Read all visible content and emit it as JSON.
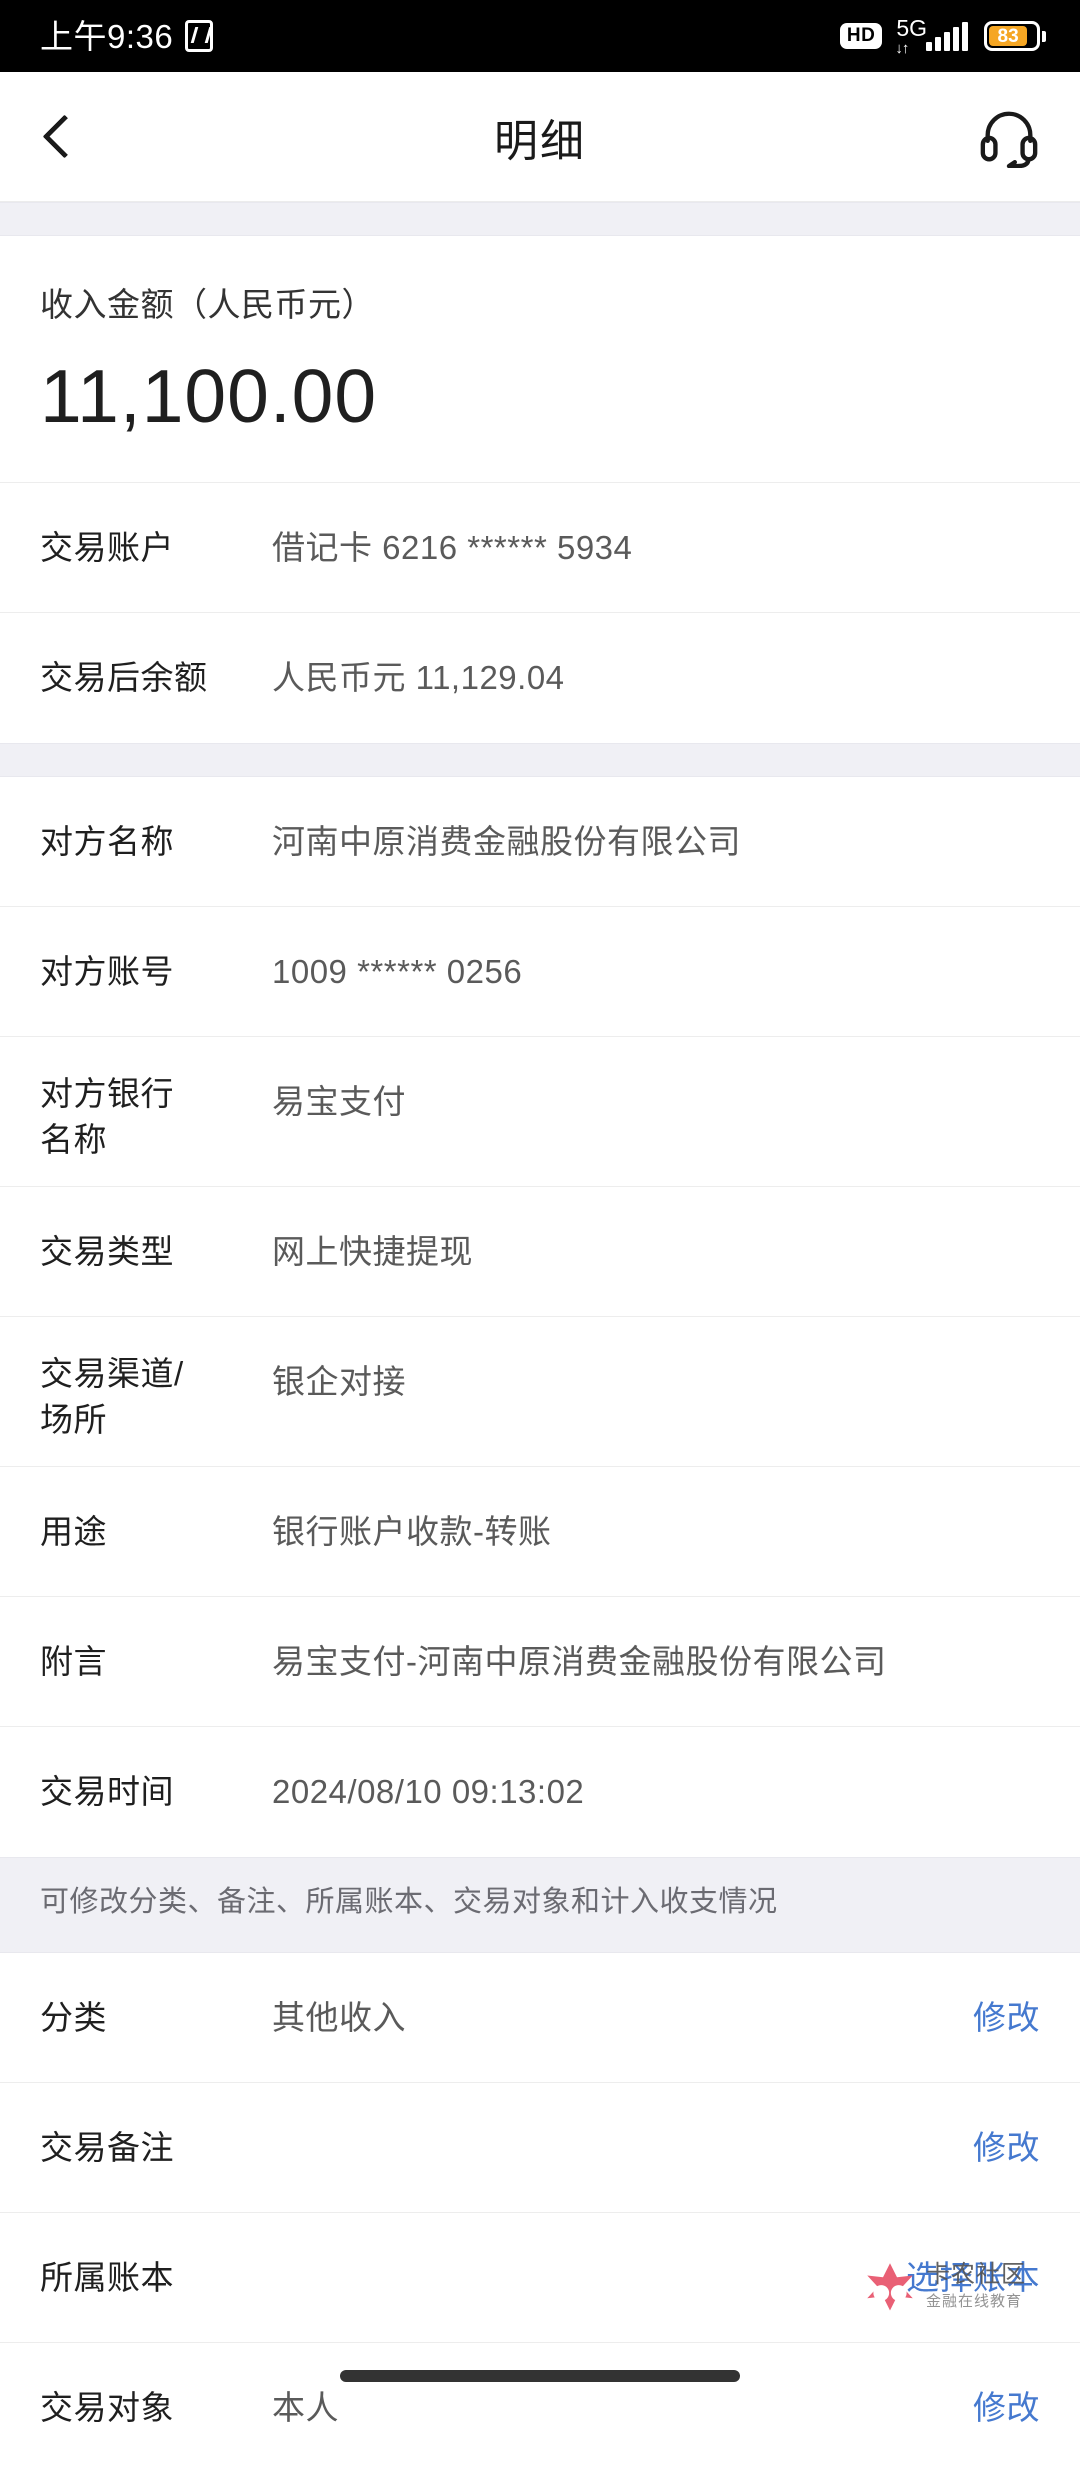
{
  "status_bar": {
    "time": "上午9:36",
    "nfc_icon": "nfc-icon",
    "hd_label": "HD",
    "network_label": "5G",
    "data_arrows": "↓↑",
    "battery_percent": "83",
    "battery_level": 83,
    "battery_color": "#f5a623"
  },
  "header": {
    "back_icon": "back-chevron-icon",
    "title": "明细",
    "support_icon": "headset-icon"
  },
  "amount": {
    "label": "收入金额（人民币元）",
    "value": "11,100.00"
  },
  "sections": [
    {
      "rows": [
        {
          "label": "交易账户",
          "value": "借记卡 6216 ****** 5934"
        },
        {
          "label": "交易后余额",
          "value": "人民币元 11,129.04"
        }
      ]
    },
    {
      "rows": [
        {
          "label": "对方名称",
          "value": "河南中原消费金融股份有限公司"
        },
        {
          "label": "对方账号",
          "value": "1009 ****** 0256"
        },
        {
          "label": "对方银行\n名称",
          "label_line1": "对方银行",
          "label_line2": "名称",
          "value": "易宝支付",
          "two_line": true
        },
        {
          "label": "交易类型",
          "value": "网上快捷提现"
        },
        {
          "label": "交易渠道/\n场所",
          "label_line1": "交易渠道/",
          "label_line2": "场所",
          "value": "银企对接",
          "two_line": true
        },
        {
          "label": "用途",
          "value": "银行账户收款-转账"
        },
        {
          "label": "附言",
          "value": "易宝支付-河南中原消费金融股份有限公司"
        },
        {
          "label": "交易时间",
          "value": "2024/08/10 09:13:02"
        }
      ]
    }
  ],
  "hint": {
    "text": "可修改分类、备注、所属账本、交易对象和计入收支情况"
  },
  "editable_rows": [
    {
      "label": "分类",
      "value": "其他收入",
      "action": "修改"
    },
    {
      "label": "交易备注",
      "value": "",
      "action": "修改"
    },
    {
      "label": "所属账本",
      "value": "",
      "action": "选择账本"
    },
    {
      "label": "交易对象",
      "value": "本人",
      "action": "修改"
    }
  ],
  "watermark": {
    "main": "卡农社区",
    "sub": "金融在线教育",
    "logo_color": "#e8536a"
  },
  "colors": {
    "link": "#4579cf",
    "band": "#f0f0f5",
    "text_primary": "#1f1f1f",
    "text_secondary": "#5a5a5a"
  }
}
